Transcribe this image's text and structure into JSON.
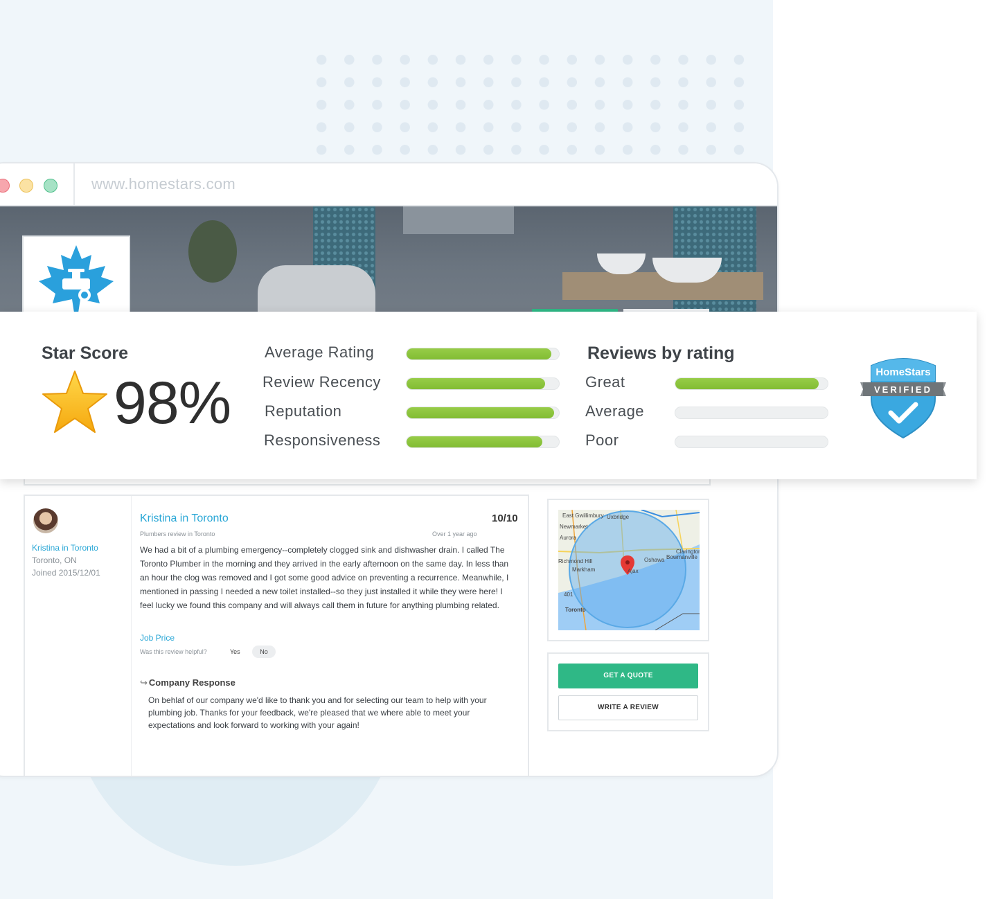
{
  "browser": {
    "url": "www.homestars.com"
  },
  "colors": {
    "accent_green": "#2fb886",
    "bar_green": "#8bc53f",
    "link_blue": "#2aa7d6",
    "badge_blue": "#3aa8e0"
  },
  "score_panel": {
    "star_score_title": "Star Score",
    "star_score_value": "98%",
    "metrics": [
      {
        "label": "Average Rating",
        "fill": 0.95
      },
      {
        "label": "Review Recency",
        "fill": 0.91
      },
      {
        "label": "Reputation",
        "fill": 0.97
      },
      {
        "label": "Responsiveness",
        "fill": 0.89
      }
    ],
    "reviews_by_rating_title": "Reviews by rating",
    "ratings": [
      {
        "label": "Great",
        "fill": 0.94
      },
      {
        "label": "Average",
        "fill": 0.0
      },
      {
        "label": "Poor",
        "fill": 0.0
      }
    ],
    "badge": {
      "brand": "HomeStars",
      "ribbon": "VERIFIED",
      "icon": "check-shield-icon"
    }
  },
  "review": {
    "reviewer_name": "Kristina in Toronto",
    "reviewer_location": "Toronto, ON",
    "reviewer_joined": "Joined 2015/12/01",
    "title": "Kristina in Toronto",
    "score": "10/10",
    "category": "Plumbers review in Toronto",
    "age": "Over 1 year ago",
    "body": "We had a bit of a plumbing emergency--completely clogged sink and dishwasher drain. I called The Toronto Plumber in the morning and they arrived in the early afternoon on the same day. In less than an hour the clog was removed and I got some good advice on preventing a recurrence. Meanwhile, I mentioned in passing I needed a new toilet installed--so they just installed it while they were here! I feel lucky we found this company and will always call them in future for anything plumbing related.",
    "job_price_label": "Job Price",
    "helpful_question": "Was this review helpful?",
    "yes_label": "Yes",
    "no_label": "No",
    "response_title": "Company Response",
    "response_body": "On behlaf of our company we'd like to thank you and for selecting our team to help with your plumbing job. Thanks for your feedback, we're pleased that we where able to meet your expectations and look forward to working with your again!"
  },
  "map": {
    "labels": [
      "East Gwillimbury",
      "Aurora",
      "Newmarket",
      "Richmond Hill",
      "Markham",
      "Oshawa",
      "Bowmanville",
      "Clarington",
      "Ajax",
      "Toronto",
      "401",
      "Uxbridge"
    ]
  },
  "actions": {
    "get_quote_label": "GET A QUOTE",
    "write_review_label": "WRITE A REVIEW"
  }
}
